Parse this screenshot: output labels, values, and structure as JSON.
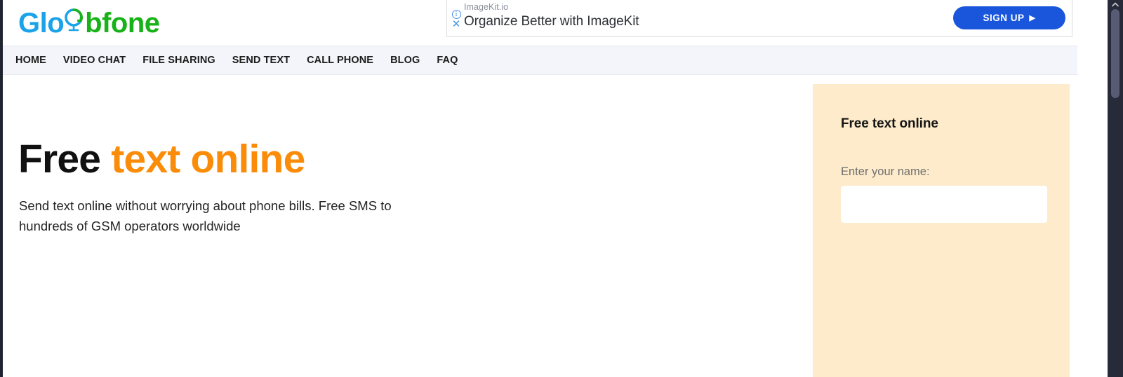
{
  "brand": {
    "name_part1": "Glo",
    "name_part2": "bfone",
    "globe_icon": "globe-icon",
    "color_blue": "#1aa3e8",
    "color_green": "#18b218"
  },
  "ad": {
    "info_icon": "info-circle-icon",
    "close_icon": "close-x-icon",
    "source": "ImageKit.io",
    "headline": "Organize Better with ImageKit",
    "signup_label": "SIGN UP",
    "signup_caret": "▶",
    "signup_color": "#1a56db"
  },
  "nav": {
    "items": [
      {
        "label": "HOME"
      },
      {
        "label": "VIDEO CHAT"
      },
      {
        "label": "FILE SHARING"
      },
      {
        "label": "SEND TEXT"
      },
      {
        "label": "CALL PHONE"
      },
      {
        "label": "BLOG"
      },
      {
        "label": "FAQ"
      }
    ]
  },
  "hero": {
    "title_dark": "Free",
    "title_accent": "text online",
    "accent_color": "#fa8c0a",
    "description": "Send text online without worrying about phone bills. Free SMS to hundreds of GSM operators worldwide"
  },
  "panel": {
    "title": "Free text online",
    "name_label": "Enter your name:",
    "name_value": "",
    "name_placeholder": "",
    "background_color": "#fdebcb"
  },
  "scrollbar": {
    "up_arrow_icon": "chevron-up-icon",
    "track_color": "#272a38",
    "thumb_color": "#575b74"
  }
}
